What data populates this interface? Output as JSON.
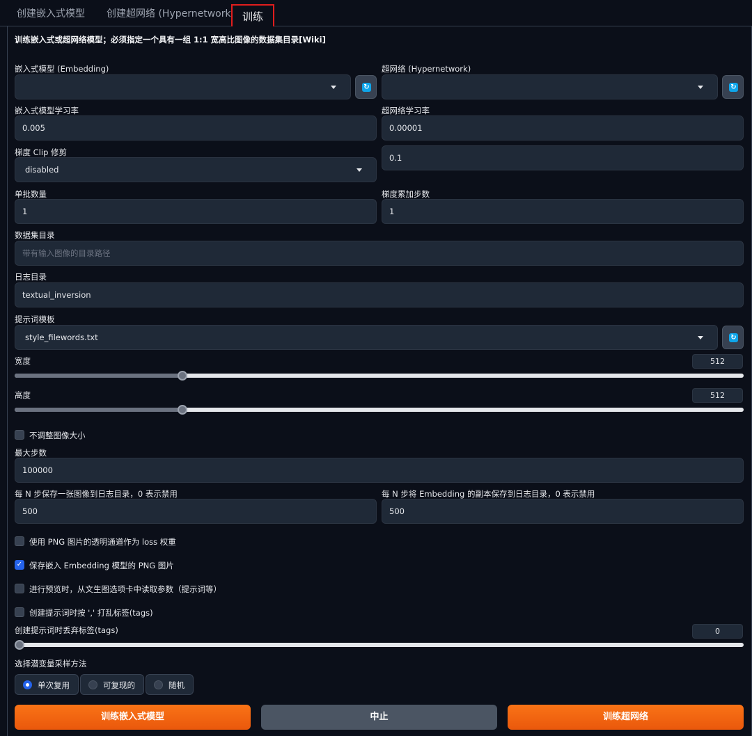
{
  "tabs": [
    {
      "label": "创建嵌入式模型"
    },
    {
      "label": "创建超网络 (Hypernetwork)"
    },
    {
      "label": "训练"
    }
  ],
  "description": "训练嵌入式或超网络模型；必须指定一个具有一组 1:1 宽高比图像的数据集目录[Wiki]",
  "embedding": {
    "label": "嵌入式模型 (Embedding)",
    "value": ""
  },
  "hypernetwork": {
    "label": "超网络 (Hypernetwork)",
    "value": ""
  },
  "embedding_lr": {
    "label": "嵌入式模型学习率",
    "value": "0.005"
  },
  "hypernetwork_lr": {
    "label": "超网络学习率",
    "value": "0.00001"
  },
  "gradient_clip": {
    "label": "梯度 Clip 修剪",
    "value": "disabled"
  },
  "clip_value": {
    "value": "0.1"
  },
  "batch_size": {
    "label": "单批数量",
    "value": "1"
  },
  "grad_accum": {
    "label": "梯度累加步数",
    "value": "1"
  },
  "dataset_dir": {
    "label": "数据集目录",
    "placeholder": "带有输入图像的目录路径"
  },
  "log_dir": {
    "label": "日志目录",
    "value": "textual_inversion"
  },
  "prompt_template": {
    "label": "提示词模板",
    "value": "style_filewords.txt"
  },
  "width": {
    "label": "宽度",
    "value": "512",
    "fraction": 0.23
  },
  "height": {
    "label": "高度",
    "value": "512",
    "fraction": 0.23
  },
  "no_resize": {
    "label": "不调整图像大小",
    "checked": false
  },
  "max_steps": {
    "label": "最大步数",
    "value": "100000"
  },
  "save_image_every": {
    "label": "每 N 步保存一张图像到日志目录，0 表示禁用",
    "value": "500"
  },
  "save_embedding_every": {
    "label": "每 N 步将 Embedding 的副本保存到日志目录，0 表示禁用",
    "value": "500"
  },
  "checkboxes": [
    {
      "label": "使用 PNG 图片的透明通道作为 loss 权重",
      "checked": false
    },
    {
      "label": "保存嵌入 Embedding 模型的 PNG 图片",
      "checked": true
    },
    {
      "label": "进行预览时，从文生图选项卡中读取参数（提示词等）",
      "checked": false
    },
    {
      "label": "创建提示词时按 ',' 打乱标签(tags)",
      "checked": false
    }
  ],
  "tag_dropout": {
    "label": "创建提示词时丢弃标签(tags)",
    "value": "0",
    "fraction": 0.0
  },
  "latent_sampling": {
    "label": "选择潜变量采样方法",
    "options": [
      "单次复用",
      "可复现的",
      "随机"
    ],
    "selected": "单次复用"
  },
  "buttons": {
    "train_embedding": "训练嵌入式模型",
    "interrupt": "中止",
    "train_hypernetwork": "训练超网络"
  },
  "colors": {
    "accent": "#f97316",
    "checkbox": "#2563eb",
    "refresh": "#0ea5e9"
  }
}
